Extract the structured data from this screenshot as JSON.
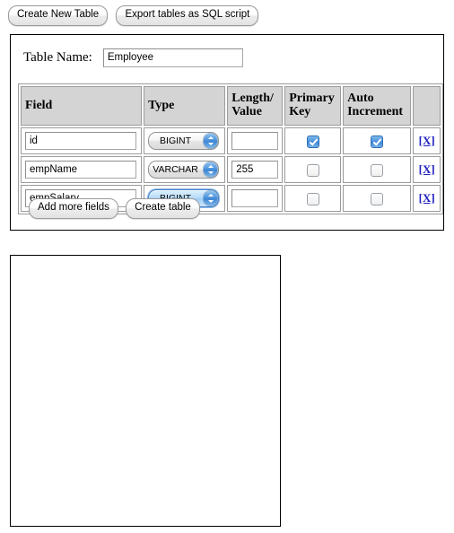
{
  "toolbar": {
    "create_new_table_label": "Create New Table",
    "export_sql_label": "Export tables as SQL script"
  },
  "form": {
    "table_name_label": "Table Name:",
    "table_name_value": "Employee",
    "table_name_placeholder": "",
    "add_more_fields_label": "Add more fields",
    "create_table_label": "Create table",
    "columns": [
      "Field",
      "Type",
      "Length/Value",
      "Primary Key",
      "Auto Increment",
      ""
    ],
    "column_headers": {
      "field": "Field",
      "type": "Type",
      "length_line1": "Length/",
      "length_line2": "Value",
      "pk_line1": "Primary",
      "pk_line2": "Key",
      "ai_line1": "Auto",
      "ai_line2": "Increment",
      "delete": ""
    },
    "type_options": [
      "BIGINT",
      "VARCHAR"
    ],
    "delete_link_label": "[X]",
    "rows": [
      {
        "field": "id",
        "type": "BIGINT",
        "length": "",
        "primary_key": true,
        "auto_increment": true,
        "type_focused": false,
        "delete": "[X]"
      },
      {
        "field": "empName",
        "type": "VARCHAR",
        "length": "255",
        "primary_key": false,
        "auto_increment": false,
        "type_focused": false,
        "delete": "[X]"
      },
      {
        "field": "empSalary",
        "type": "BIGINT",
        "length": "",
        "primary_key": false,
        "auto_increment": false,
        "type_focused": true,
        "delete": "[X]"
      }
    ]
  },
  "output": {
    "text": ""
  },
  "colors": {
    "header_background": "#d4d4d4",
    "link": "#2020c0",
    "accent_blue": "#3f86d4",
    "border": "#000000"
  }
}
